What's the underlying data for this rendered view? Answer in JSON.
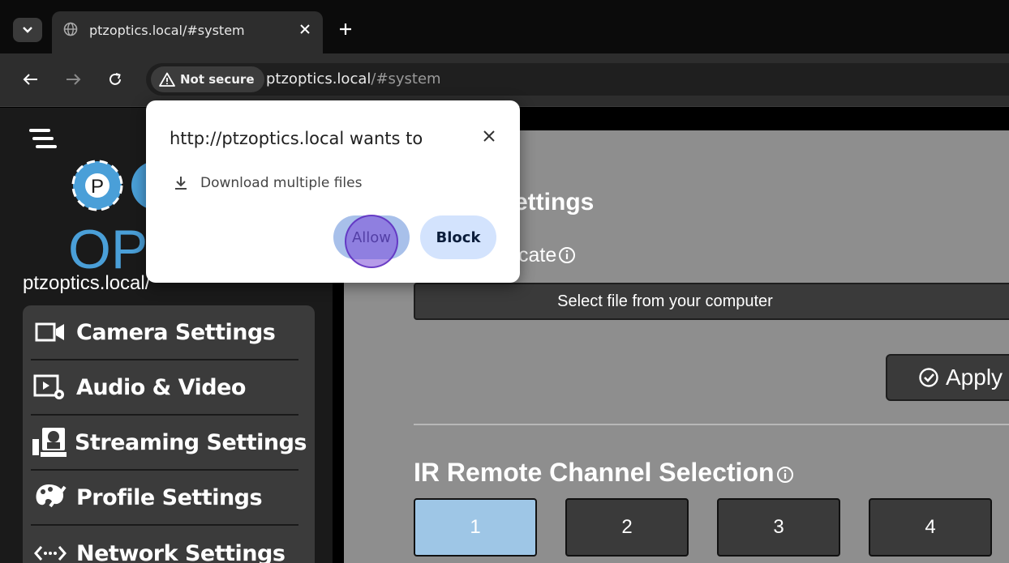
{
  "browser": {
    "tab": {
      "title": "ptzoptics.local/#system"
    },
    "security_chip": "Not secure",
    "url_host": "ptzoptics.local",
    "url_path": "/#system"
  },
  "popup": {
    "title": "http://ptzoptics.local wants to",
    "permission": "Download multiple files",
    "allow_label": "Allow",
    "block_label": "Block"
  },
  "sidebar": {
    "device_name": "ptzoptics.local/",
    "logo_text": "P",
    "logo_letters": "OP",
    "items": [
      {
        "label": "Camera Settings",
        "icon": "video-camera-icon"
      },
      {
        "label": "Audio & Video",
        "icon": "video-settings-icon"
      },
      {
        "label": "Streaming Settings",
        "icon": "streaming-icon"
      },
      {
        "label": "Profile Settings",
        "icon": "palette-icon"
      },
      {
        "label": "Network Settings",
        "icon": "network-icon"
      }
    ]
  },
  "content": {
    "section_title_fragment": "ettings",
    "cert_label_fragment": "tificate",
    "file_button": "Select file from your computer",
    "apply_label": "Apply",
    "ir_title": "IR Remote Channel Selection",
    "channels": [
      "1",
      "2",
      "3",
      "4"
    ],
    "active_channel": "1"
  },
  "colors": {
    "accent_allow": "#a8c0ea",
    "click_ring": "#7a48d7",
    "active_channel": "#9ec6e6",
    "logo_blue": "#4a9fd8"
  }
}
